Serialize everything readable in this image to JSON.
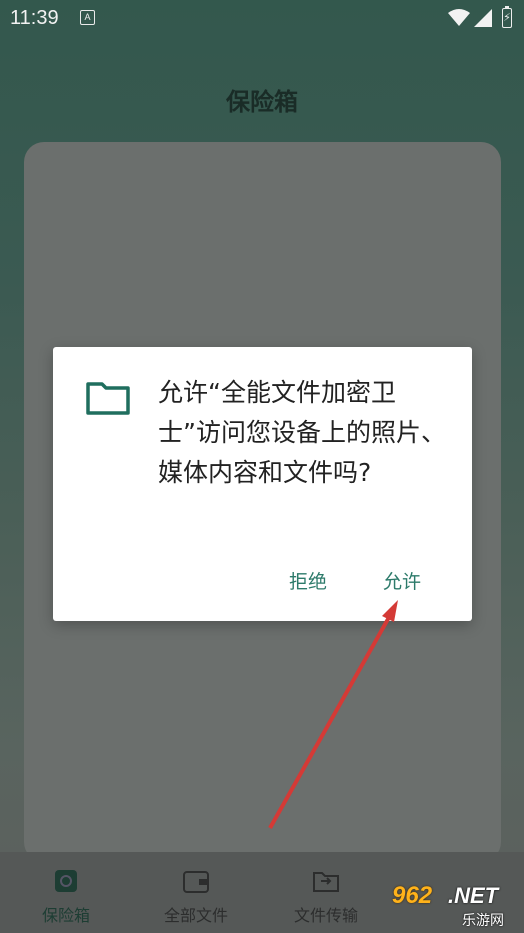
{
  "status_bar": {
    "time": "11:39",
    "notification_icon": "A"
  },
  "header": {
    "title": "保险箱"
  },
  "dialog": {
    "message": "允许“全能文件加密卫士”访问您设备上的照片、媒体内容和文件吗?",
    "deny_label": "拒绝",
    "allow_label": "允许"
  },
  "bottom_nav": {
    "items": [
      {
        "label": "保险箱",
        "icon": "safe-icon",
        "active": true
      },
      {
        "label": "全部文件",
        "icon": "wallet-icon",
        "active": false
      },
      {
        "label": "文件传输",
        "icon": "transfer-folder-icon",
        "active": false
      }
    ]
  },
  "watermark": {
    "brand": "962",
    "domain": ".NET",
    "subtitle": "乐游网"
  },
  "colors": {
    "accent": "#2c7a6a",
    "folder": "#1f6e5e",
    "annotation_arrow": "#d43a36"
  }
}
